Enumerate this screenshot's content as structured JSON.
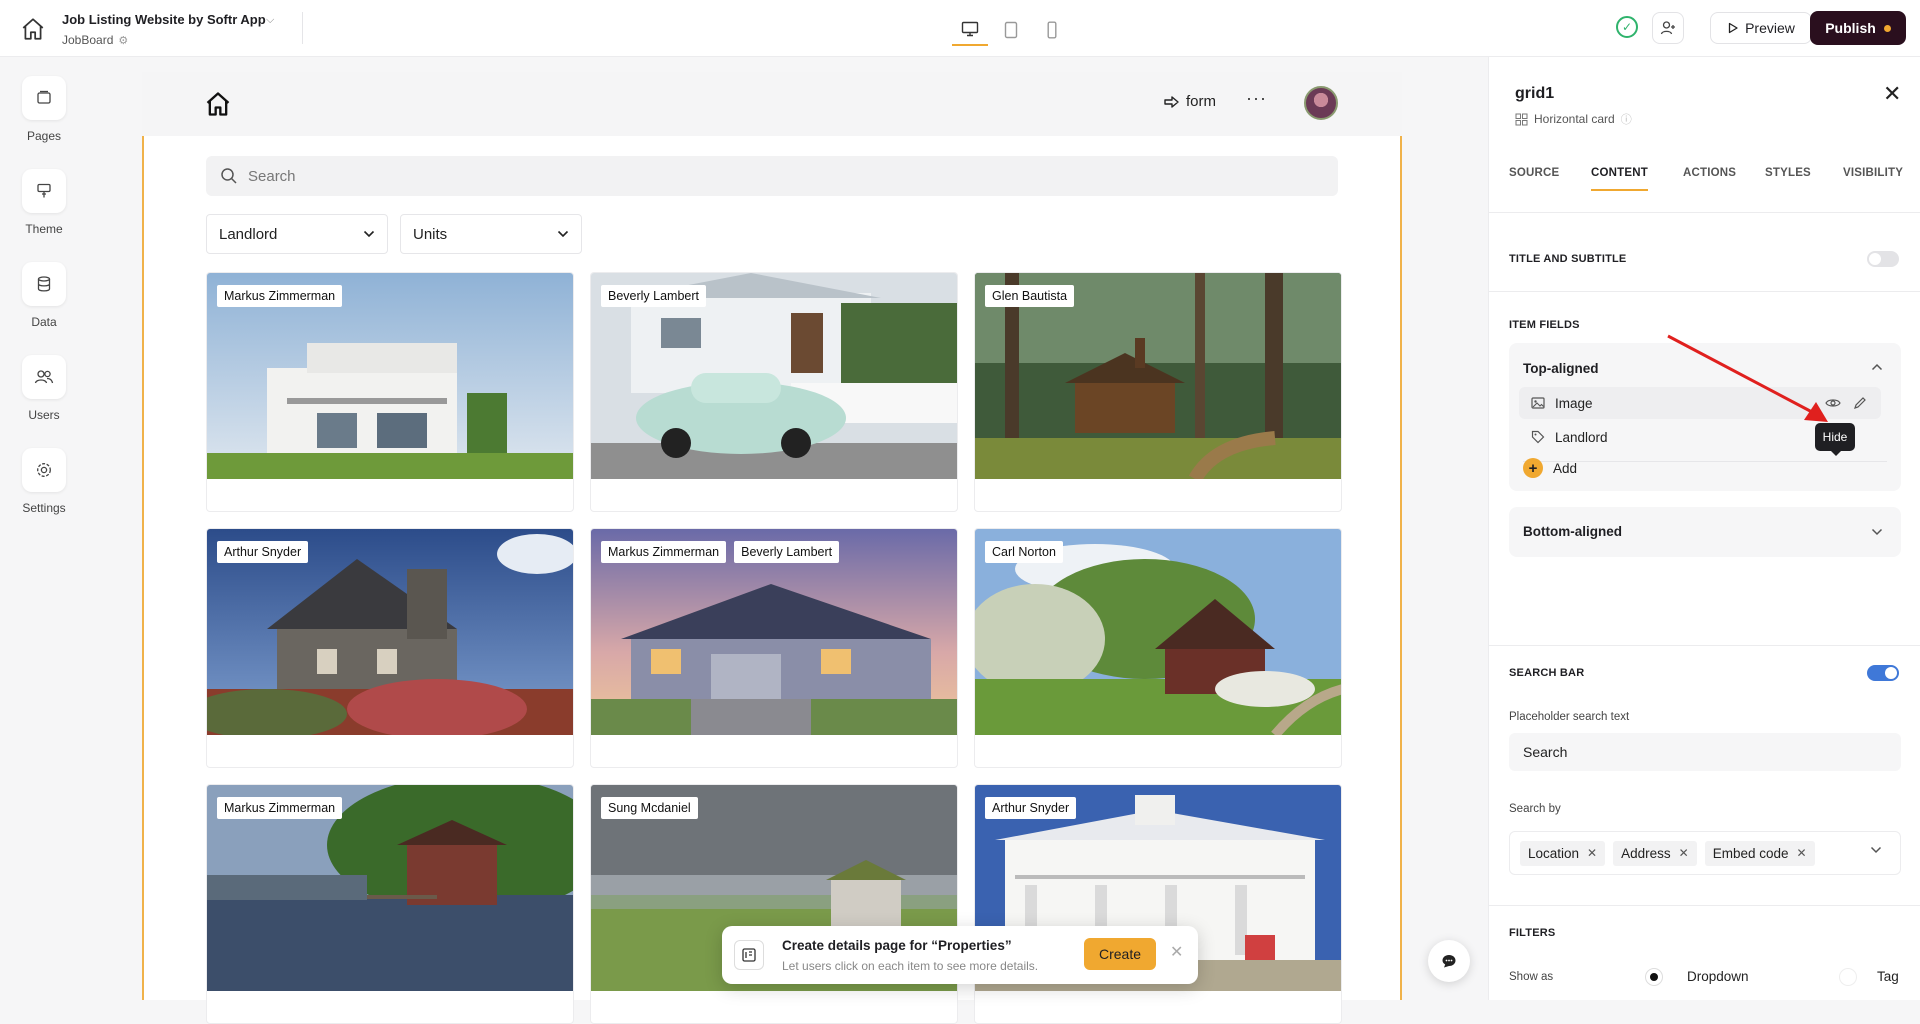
{
  "topbar": {
    "app_title": "Job Listing Website by Softr App",
    "app_subtitle": "JobBoard",
    "preview_label": "Preview",
    "publish_label": "Publish"
  },
  "leftnav": {
    "items": [
      {
        "label": "Pages",
        "icon": "pages-icon"
      },
      {
        "label": "Theme",
        "icon": "theme-icon"
      },
      {
        "label": "Data",
        "icon": "database-icon"
      },
      {
        "label": "Users",
        "icon": "users-icon"
      },
      {
        "label": "Settings",
        "icon": "gear-icon"
      }
    ]
  },
  "canvas": {
    "form_link": "form",
    "search_placeholder": "Search",
    "filters": [
      {
        "label": "Landlord"
      },
      {
        "label": "Units"
      }
    ],
    "cards": [
      {
        "tags": [
          "Markus Zimmerman"
        ],
        "scene": "modern-villa"
      },
      {
        "tags": [
          "Beverly Lambert"
        ],
        "scene": "beetle-house"
      },
      {
        "tags": [
          "Glen Bautista"
        ],
        "scene": "forest-cabin"
      },
      {
        "tags": [
          "Arthur Snyder"
        ],
        "scene": "stone-house"
      },
      {
        "tags": [
          "Markus Zimmerman",
          "Beverly Lambert"
        ],
        "scene": "suburban-house"
      },
      {
        "tags": [
          "Carl Norton"
        ],
        "scene": "country-cottage"
      },
      {
        "tags": [
          "Markus Zimmerman"
        ],
        "scene": "lake-boathouse"
      },
      {
        "tags": [
          "Sung Mcdaniel"
        ],
        "scene": "meadow-house"
      },
      {
        "tags": [
          "Arthur Snyder"
        ],
        "scene": "white-mansion"
      }
    ],
    "toast": {
      "title": "Create details page for “Properties”",
      "subtitle": "Let users click on each item to see more details.",
      "button": "Create"
    }
  },
  "panel": {
    "block_name": "grid1",
    "block_type": "Horizontal card",
    "tabs": [
      {
        "label": "SOURCE",
        "active": false
      },
      {
        "label": "CONTENT",
        "active": true
      },
      {
        "label": "ACTIONS",
        "active": false
      },
      {
        "label": "STYLES",
        "active": false
      },
      {
        "label": "VISIBILITY",
        "active": false
      }
    ],
    "title_subtitle_label": "TITLE AND SUBTITLE",
    "title_subtitle_on": false,
    "item_fields_label": "ITEM FIELDS",
    "top_aligned": {
      "label": "Top-aligned",
      "fields": [
        {
          "label": "Image",
          "icon": "image-icon"
        },
        {
          "label": "Landlord",
          "icon": "tag-icon"
        }
      ],
      "add_label": "Add",
      "tooltip": "Hide"
    },
    "bottom_aligned_label": "Bottom-aligned",
    "search_bar_label": "SEARCH BAR",
    "search_bar_on": true,
    "placeholder_label": "Placeholder search text",
    "placeholder_value": "Search",
    "search_by_label": "Search by",
    "search_by": [
      "Location",
      "Address",
      "Embed code"
    ],
    "filters_label": "FILTERS",
    "show_as_label": "Show as",
    "show_as_options": [
      {
        "label": "Dropdown",
        "selected": true
      },
      {
        "label": "Tag",
        "selected": false
      }
    ]
  },
  "colors": {
    "accent": "#f0a830",
    "publish_bg": "#2a0f1e",
    "toggle_on": "#3f78d8",
    "arrow": "#e0201e"
  }
}
